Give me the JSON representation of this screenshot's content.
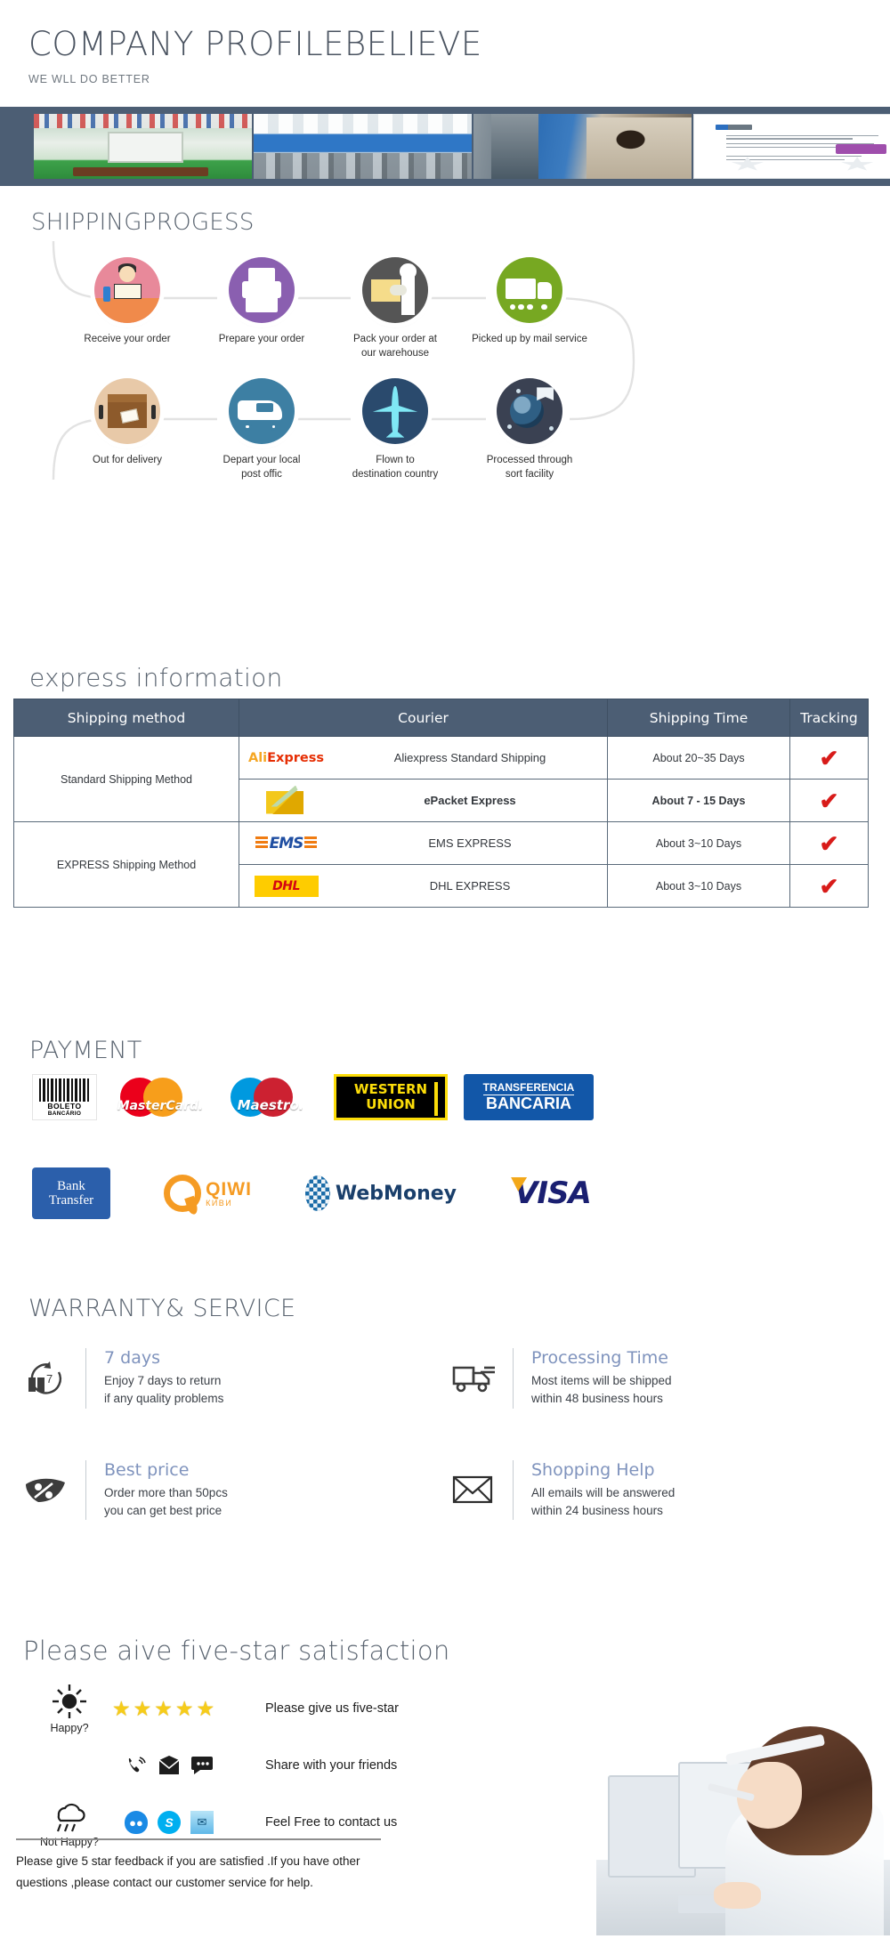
{
  "header": {
    "title": "COMPANY PROFILEBELIEVE",
    "subtitle": "WE WLL DO BETTER"
  },
  "banner": {
    "photos": [
      {
        "name": "showroom-photo",
        "alt": "Product showroom with flags"
      },
      {
        "name": "office-photo",
        "alt": "Open plan office with staff"
      },
      {
        "name": "factory-photo",
        "alt": "Factory assembly line workers"
      },
      {
        "name": "certificate-photo",
        "alt": "Registration certificate"
      }
    ]
  },
  "shipping_progress": {
    "title": "SHIPPINGPROGESS",
    "steps": [
      {
        "label": "Receive your order",
        "icon": "person-at-desk-icon",
        "color": "#e8899a"
      },
      {
        "label": "Prepare your order",
        "icon": "printer-icon",
        "color": "#8a5fb0"
      },
      {
        "label": "Pack your order at\nour warehouse",
        "line1": "Pack your order at",
        "line2": "our warehouse",
        "icon": "worker-packing-icon",
        "color": "#555555"
      },
      {
        "label": "Picked up by mail service",
        "icon": "truck-icon",
        "color": "#77a822"
      },
      {
        "label": "Out for delivery",
        "icon": "parcel-crate-icon",
        "color": "#e8c9a8"
      },
      {
        "label": "Depart your local\npost offic",
        "line1": "Depart your local",
        "line2": "post offic",
        "icon": "van-icon",
        "color": "#3d7fa3"
      },
      {
        "label": "Flown to\ndestination country",
        "line1": "Flown to",
        "line2": "destination country",
        "icon": "airplane-icon",
        "color": "#2a4a6d"
      },
      {
        "label": "Processed through\nsort facility",
        "line1": "Processed through",
        "line2": "sort facility",
        "icon": "globe-mail-icon",
        "color": "#3a4152"
      }
    ]
  },
  "express": {
    "title": "express information",
    "columns": [
      "Shipping method",
      "Courier",
      "Shipping Time",
      "Tracking"
    ],
    "groups": [
      {
        "method": "Standard Shipping Method",
        "rows": [
          {
            "logo": "aliexpress-logo",
            "logo_text_a": "Ali",
            "logo_text_b": "Express",
            "courier": "Aliexpress Standard Shipping",
            "time": "About 20~35 Days",
            "tracking": "✔"
          },
          {
            "logo": "epacket-logo",
            "courier": "ePacket Express",
            "time": "About 7 - 15 Days",
            "tracking": "✔"
          }
        ]
      },
      {
        "method": "EXPRESS Shipping Method",
        "rows": [
          {
            "logo": "ems-logo",
            "logo_text": "EMS",
            "courier": "EMS EXPRESS",
            "time": "About 3~10 Days",
            "tracking": "✔"
          },
          {
            "logo": "dhl-logo",
            "logo_text": "DHL",
            "courier": "DHL EXPRESS",
            "time": "About 3~10 Days",
            "tracking": "✔"
          }
        ]
      }
    ],
    "tracking_color": "#d81b19",
    "header_color": "#4c5e74"
  },
  "payment": {
    "title": "PAYMENT",
    "row1": [
      {
        "name": "boleto-bancario-logo",
        "line1": "BOLETO",
        "line2": "BANCÁRIO"
      },
      {
        "name": "mastercard-logo",
        "text": "MasterCard."
      },
      {
        "name": "maestro-logo",
        "text": "Maestro."
      },
      {
        "name": "western-union-logo",
        "line1": "WESTERN",
        "line2": "UNION"
      },
      {
        "name": "transferencia-bancaria-logo",
        "line1": "TRANSFERENCIA",
        "line2": "BANCARIA"
      }
    ],
    "row2": [
      {
        "name": "bank-transfer-logo",
        "line1": "Bank",
        "line2": "Transfer"
      },
      {
        "name": "qiwi-logo",
        "text": "QIWI",
        "sub": "КИВИ"
      },
      {
        "name": "webmoney-logo",
        "text": "WebMoney"
      },
      {
        "name": "visa-logo",
        "text": "VISA"
      }
    ]
  },
  "warranty": {
    "title": "WARRANTY& SERVICE",
    "items": [
      {
        "icon": "clock-return-icon",
        "heading": "7 days",
        "line1": "Enjoy 7 days to return",
        "line2": "if any quality problems"
      },
      {
        "icon": "delivery-truck-icon",
        "heading": "Processing Time",
        "line1": "Most items will be shipped",
        "line2": "within 48 business hours"
      },
      {
        "icon": "discount-tag-icon",
        "heading": "Best price",
        "line1": "Order more than 50pcs",
        "line2": "you can get best price"
      },
      {
        "icon": "envelope-icon",
        "heading": "Shopping Help",
        "line1": "All emails will be answered",
        "line2": "within 24 business hours"
      }
    ],
    "heading_color": "#7f93bd"
  },
  "five_star": {
    "title": "Please aive five-star satisfaction",
    "moods": [
      {
        "icon": "sun-icon",
        "label": "Happy?"
      },
      {
        "icon": "rain-cloud-icon",
        "label": "Not Happy?"
      }
    ],
    "rows": [
      {
        "icons": [
          "star-icon",
          "star-icon",
          "star-icon",
          "star-icon",
          "star-icon"
        ],
        "text": "Please give us five-star",
        "star_count": 5
      },
      {
        "icons": [
          "phone-icon",
          "mail-icon",
          "chat-bubble-icon"
        ],
        "text": "Share with your friends"
      },
      {
        "icons": [
          "qq-icon",
          "skype-icon",
          "mail-blue-icon"
        ],
        "text": "Feel Free to contact us"
      }
    ],
    "note_line1": "Please give 5 star feedback if you are satisfied .If you have other",
    "note_line2": "questions ,please contact our customer service for help.",
    "star_color": "#f6cc1a"
  },
  "agent_photo": {
    "name": "customer-service-agent-photo",
    "alt": "Customer service agent with headset"
  }
}
